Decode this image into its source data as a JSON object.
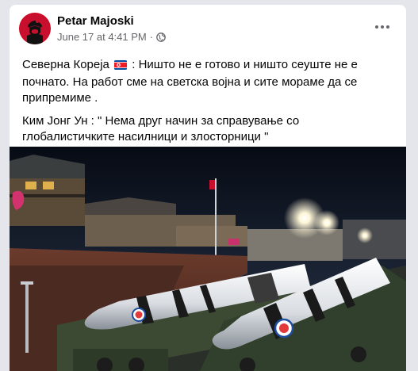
{
  "post": {
    "author": "Petar Majoski",
    "date": "June 17 at 4:41 PM",
    "separator": "·",
    "privacy_icon": "globe-icon",
    "more_icon": "more-options-icon",
    "paragraph1_a": "Северна Кореја",
    "paragraph1_flag": "north-korea-flag-icon",
    "paragraph1_b": ": Ништо не е готово и ништо сеуште не е почнато. На работ сме на светска војна и сите мораме да се припремиме .",
    "paragraph2": "Ким Јонг Ун : \" Нема друг начин за справување со глобалистичките насилници и злосторници \""
  },
  "colors": {
    "page_bg": "#e4e6eb",
    "card_bg": "#ffffff",
    "secondary_text": "#65676b",
    "primary_text": "#050505"
  }
}
